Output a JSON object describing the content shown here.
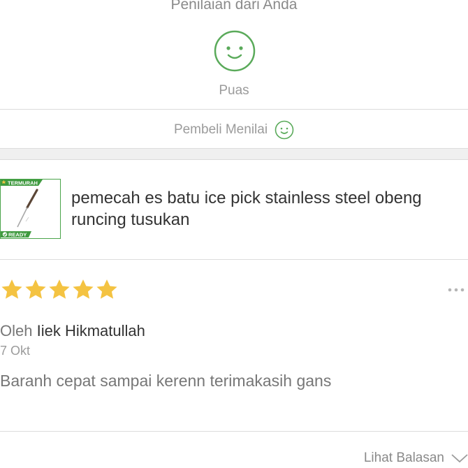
{
  "header": {
    "title": "Penilaian dari Anda"
  },
  "rating": {
    "label": "Puas",
    "icon": "smiley-face-icon",
    "color": "#5aaa5a"
  },
  "buyer": {
    "label": "Pembeli Menilai",
    "icon": "smiley-face-icon"
  },
  "product": {
    "name": "pemecah es batu ice pick stainless steel obeng runcing tusukan",
    "badge_top": "TERMURAH",
    "badge_bottom": "READY",
    "accent": "#4aa44a"
  },
  "review": {
    "stars": 5,
    "star_color": "#f4c342",
    "by_label": "Oleh",
    "reviewer_name": "Iiek Hikmatullah",
    "date": "7 Okt",
    "text": "Baranh cepat sampai kerenn terimakasih gans",
    "more_icon": "more-horizontal-icon"
  },
  "footer": {
    "reply_label": "Lihat Balasan",
    "icon": "chevron-down-icon"
  }
}
